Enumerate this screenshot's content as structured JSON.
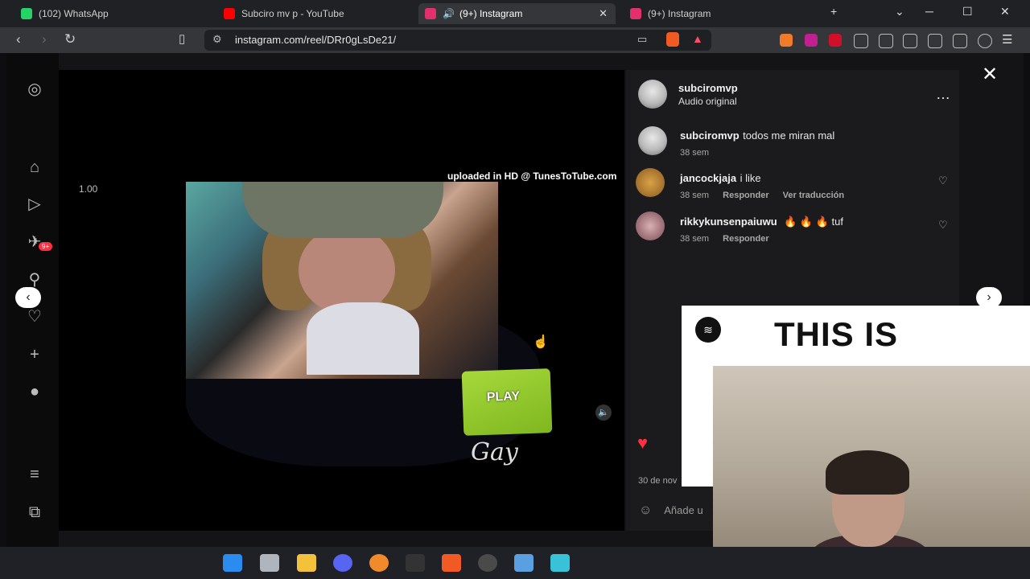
{
  "browser": {
    "tabs": [
      {
        "label": "(102) WhatsApp",
        "active": false,
        "fav_color": "#25d366"
      },
      {
        "label": "Subciro mv p - YouTube",
        "active": false,
        "fav_color": "#ff0000"
      },
      {
        "label": "(9+) Instagram",
        "active": true,
        "fav_color": "#e1306c"
      },
      {
        "label": "(9+) Instagram",
        "active": false,
        "fav_color": "#e1306c"
      }
    ],
    "new_tab": "+",
    "url": "instagram.com/reel/DRr0gLsDe21/"
  },
  "reel": {
    "watermark": "uploaded in HD @ TunesToTube.com",
    "speed": "1.00",
    "chips_label": "PLAY",
    "signature": "Gay"
  },
  "post": {
    "author": "subciromvp",
    "audio": "Audio original",
    "more": "…",
    "comments": [
      {
        "user": "subciromvp",
        "text": "todos me miran mal",
        "age": "38 sem",
        "reply": "",
        "translate": ""
      },
      {
        "user": "jancockjaja",
        "text": "i like",
        "age": "38 sem",
        "reply": "Responder",
        "translate": "Ver traducción"
      },
      {
        "user": "rikkykunsenpaiuwu",
        "text": "🔥 🔥 🔥 tuf",
        "age": "38 sem",
        "reply": "Responder",
        "translate": ""
      }
    ],
    "date": "30 de nov",
    "add_comment": "Añade u"
  },
  "overlay": {
    "spotify_text": "THIS IS"
  },
  "nav": {
    "badge": "9+"
  }
}
